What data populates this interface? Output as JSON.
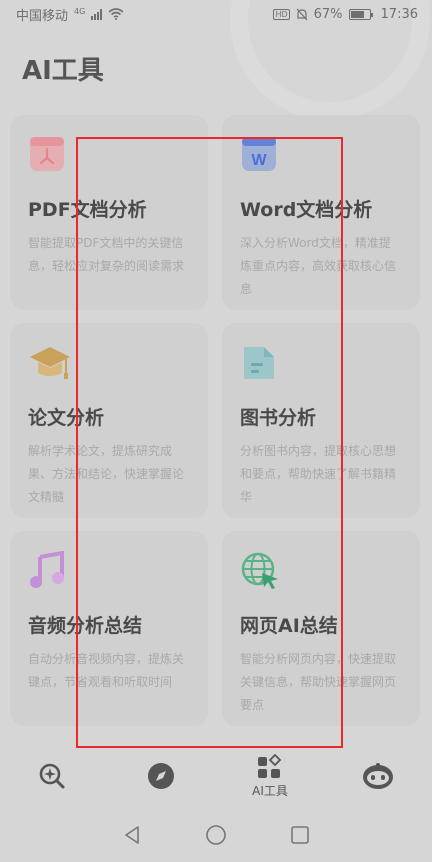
{
  "status_bar": {
    "carrier": "中国移动",
    "network": "4G",
    "battery": "67%",
    "time": "17:36"
  },
  "page": {
    "title": "AI工具"
  },
  "cards": [
    {
      "title": "PDF文档分析",
      "desc": "智能提取PDF文档中的关键信息，轻松应对复杂的阅读需求",
      "icon": "pdf-icon"
    },
    {
      "title": "Word文档分析",
      "desc": "深入分析Word文档，精准提炼重点内容，高效获取核心信息",
      "icon": "word-icon"
    },
    {
      "title": "论文分析",
      "desc": "解析学术论文，提炼研究成果、方法和结论，快速掌握论文精髓",
      "icon": "graduation-cap-icon"
    },
    {
      "title": "图书分析",
      "desc": "分析图书内容，提取核心思想和要点，帮助快速了解书籍精华",
      "icon": "book-icon"
    },
    {
      "title": "音频分析总结",
      "desc": "自动分析音视频内容，提炼关键点，节省观看和听取时间",
      "icon": "music-icon"
    },
    {
      "title": "网页AI总结",
      "desc": "智能分析网页内容，快速提取关键信息，帮助快速掌握网页要点",
      "icon": "globe-icon"
    }
  ],
  "bottom_nav": {
    "active_label": "AI工具"
  },
  "colors": {
    "highlight": "#ea2a2a",
    "pdf": "#e8838a",
    "word": "#4a6fd8",
    "graduation": "#d9a13b",
    "book": "#6fc5c9",
    "music": "#c57ad8",
    "globe": "#36b07a"
  }
}
